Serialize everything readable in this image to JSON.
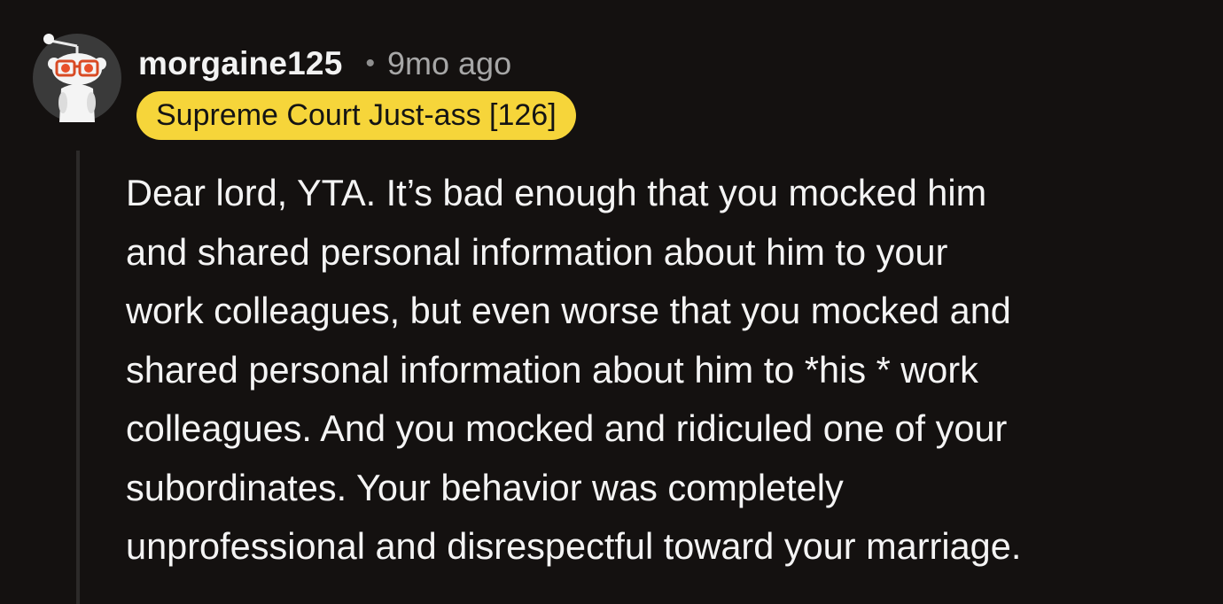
{
  "comment": {
    "author": "morgaine125",
    "separator": "•",
    "time_ago": "9mo ago",
    "flair": "Supreme Court Just-ass [126]",
    "body_lines": [
      "Dear lord, YTA. It’s bad enough that you mocked him",
      "and shared personal information about him to your",
      "work colleagues, but even worse that you mocked and",
      "shared personal information about him to *his * work",
      "colleagues. And you mocked and ridiculed one of your",
      "subordinates. Your behavior was completely",
      "unprofessional and disrespectful toward your marriage."
    ]
  },
  "colors": {
    "background": "#141110",
    "flair_background": "#f6d53a",
    "avatar_eyes": "#e8502a",
    "text": "#f4f4f4",
    "meta_text": "#a7a7a7"
  },
  "icons": {
    "avatar": "snoo-avatar-icon"
  }
}
